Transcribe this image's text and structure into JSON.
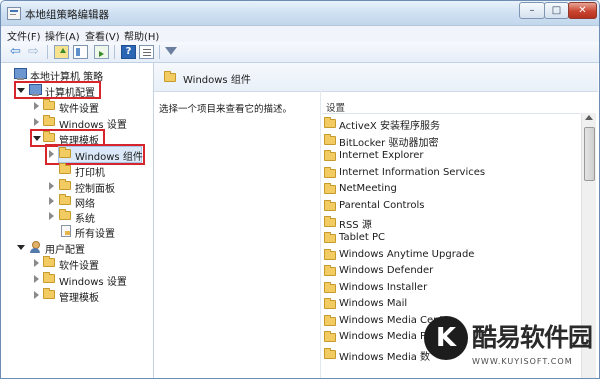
{
  "window": {
    "title": "本地组策略编辑器",
    "controls": {
      "minimize": "–",
      "maximize": "□",
      "close": "✕"
    }
  },
  "menubar": {
    "items": [
      {
        "label": "文件(F)"
      },
      {
        "label": "操作(A)"
      },
      {
        "label": "查看(V)"
      },
      {
        "label": "帮助(H)"
      }
    ]
  },
  "toolbar": {
    "icons": [
      "back-arrow-icon",
      "forward-arrow-icon",
      "up-folder-icon",
      "show-hide-tree-icon",
      "export-list-icon",
      "help-icon",
      "properties-icon",
      "filter-icon"
    ],
    "help_glyph": "?"
  },
  "tree": {
    "root": "本地计算机 策略",
    "computer_config": "计算机配置",
    "software_settings": "软件设置",
    "windows_settings": "Windows 设置",
    "admin_templates": "管理模板",
    "windows_components": "Windows 组件",
    "printers": "打印机",
    "control_panel": "控制面板",
    "network": "网络",
    "system": "系统",
    "all_settings": "所有设置",
    "user_config": "用户配置",
    "user_software_settings": "软件设置",
    "user_windows_settings": "Windows 设置",
    "user_admin_templates": "管理模板"
  },
  "details": {
    "header_title": "Windows 组件",
    "description_prompt": "选择一个项目来查看它的描述。",
    "column_setting": "设置",
    "items": [
      "ActiveX 安装程序服务",
      "BitLocker 驱动器加密",
      "Internet Explorer",
      "Internet Information Services",
      "NetMeeting",
      "Parental Controls",
      "RSS 源",
      "Tablet PC",
      "Windows Anytime Upgrade",
      "Windows Defender",
      "Windows Installer",
      "Windows Mail",
      "Windows Media Center",
      "Windows Media Playe",
      "Windows Media 数"
    ]
  },
  "annotation_color": "#d6252c",
  "watermark": {
    "logo_letter": "K",
    "text": "酷易软件园",
    "url": "WWW.KUYISOFT.COM"
  }
}
